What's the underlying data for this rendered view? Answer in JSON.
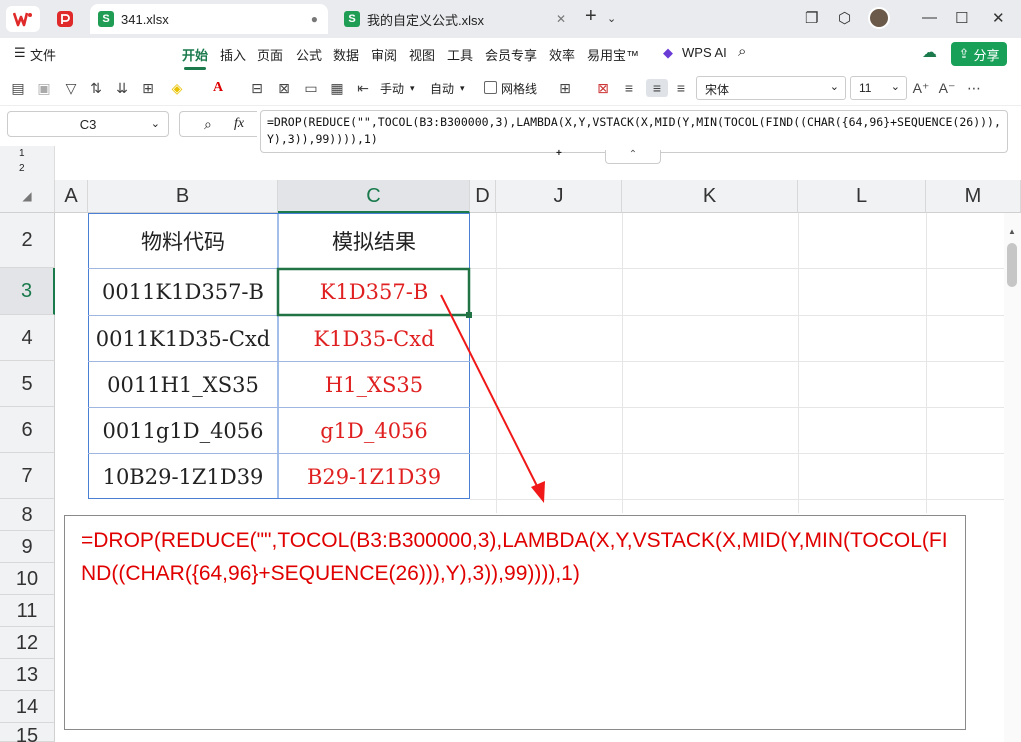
{
  "tabs": {
    "file1": "341.xlsx",
    "file2": "我的自定义公式.xlsx"
  },
  "menu": {
    "file": "文件",
    "start": "开始",
    "insert": "插入",
    "page": "页面",
    "formula": "公式",
    "data": "数据",
    "review": "审阅",
    "view": "视图",
    "tools": "工具",
    "member": "会员专享",
    "efficiency": "效率",
    "yiyongbao": "易用宝™",
    "wpsai": "WPS AI",
    "share": "分享"
  },
  "toolbar": {
    "manual": "手动",
    "auto": "自动",
    "gridlines": "网格线",
    "font_name": "宋体",
    "font_size": "11"
  },
  "formula_bar": {
    "cell_ref": "C3",
    "fx": "fx",
    "formula": "=DROP(REDUCE(\"\",TOCOL(B3:B300000,3),LAMBDA(X,Y,VSTACK(X,MID(Y,MIN(TOCOL(FIND((CHAR({64,96}+SEQUENCE(26))),Y),3)),99)))),1)"
  },
  "outline_levels": [
    "1",
    "2"
  ],
  "columns": [
    "A",
    "B",
    "C",
    "D",
    "J",
    "K",
    "L",
    "M"
  ],
  "rows": [
    "2",
    "3",
    "4",
    "5",
    "6",
    "7",
    "8",
    "9",
    "10",
    "11",
    "12",
    "13",
    "14",
    "15"
  ],
  "table": {
    "header_b": "物料代码",
    "header_c": "模拟结果",
    "data": [
      {
        "code": "0011K1D357-B",
        "result": "K1D357-B"
      },
      {
        "code": "0011K1D35-Cxd",
        "result": "K1D35-Cxd"
      },
      {
        "code": "0011H1_XS35",
        "result": "H1_XS35"
      },
      {
        "code": "0011g1D_4056",
        "result": "g1D_4056"
      },
      {
        "code": "10B29-1Z1D39",
        "result": "B29-1Z1D39"
      }
    ]
  },
  "formula_display": "=DROP(REDUCE(\"\",TOCOL(B3:B300000,3),LAMBDA(X,Y,VSTACK(X,MID(Y,MIN(TOCOL(FIND((CHAR({64,96}+SEQUENCE(26))),Y),3)),99)))),1)",
  "colors": {
    "accent": "#1a7a4c",
    "result_red": "#e02020",
    "selection_green": "#217346",
    "border_blue": "#3b6fd4"
  }
}
